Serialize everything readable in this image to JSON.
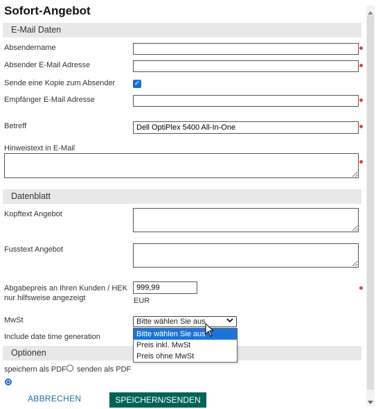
{
  "title": "Sofort-Angebot",
  "sections": {
    "email": "E-Mail Daten",
    "datasheet": "Datenblatt",
    "options": "Optionen"
  },
  "email": {
    "sender_name_label": "Absendername",
    "sender_name_value": "",
    "sender_email_label": "Absender E-Mail Adresse",
    "sender_email_value": "",
    "copy_label": "Sende eine Kopie zum Absender",
    "copy_checked": true,
    "recipient_label": "Empfänger E-Mail Adresse",
    "recipient_value": "",
    "subject_label": "Betreff",
    "subject_value": "Dell OptiPlex 5400 All-In-One",
    "note_label": "Hinweistext in E-Mail",
    "note_value": ""
  },
  "datasheet": {
    "header_label": "Kopftext Angebot",
    "footer_label": "Fusstext Angebot",
    "price_label_line1": "Abgabepreis an Ihren Kunden / HEK",
    "price_label_line2": "nur hilfsweise angezeigt",
    "price_value": "999,99",
    "currency": "EUR",
    "vat_label": "MwSt",
    "vat_selected": "Bitte wählen Sie aus",
    "vat_options": [
      "Bitte wählen Sie aus",
      "Preis inkl. MwSt",
      "Preis ohne MwSt"
    ],
    "include_date_label": "Include date time generation"
  },
  "options": {
    "save_pdf_label": "speichern als PDF",
    "send_pdf_label": "senden als PDF"
  },
  "buttons": {
    "cancel": "ABBRECHEN",
    "save": "SPEICHERN/SENDEN"
  },
  "colors": {
    "save_button": "#006357",
    "cancel_text": "#1a6fa6",
    "selection": "#1e73d9",
    "required_dot": "#e04040"
  }
}
